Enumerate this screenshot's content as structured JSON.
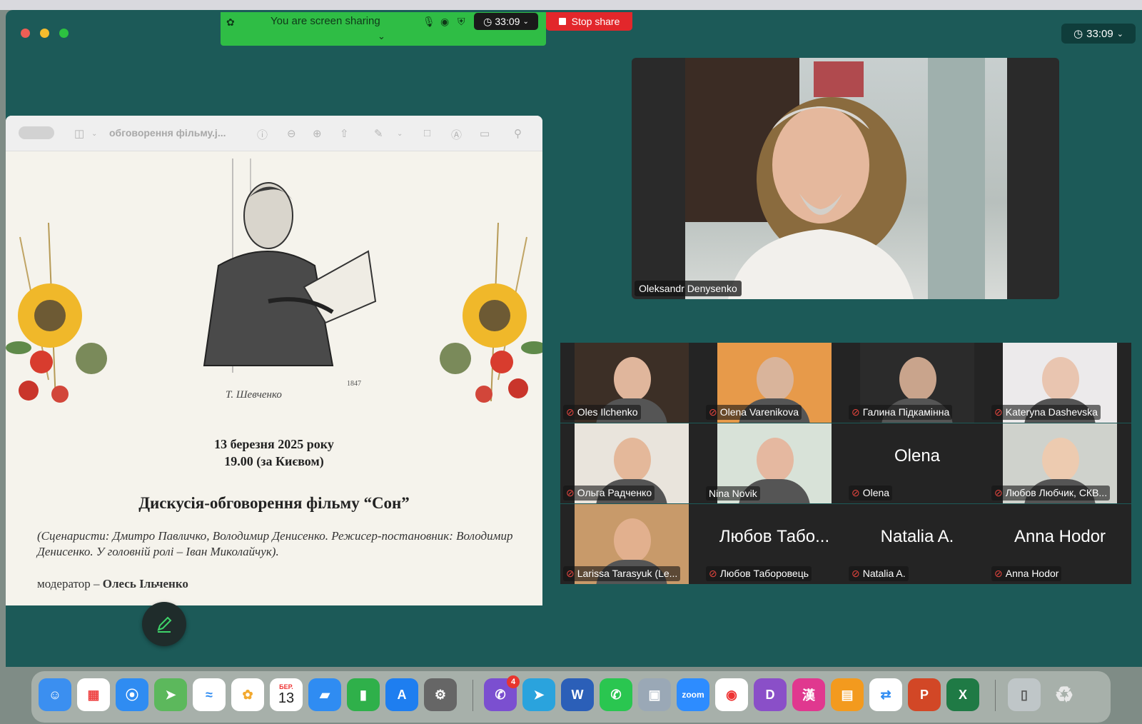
{
  "share_bar": {
    "label": "You are screen sharing",
    "timer": "33:09",
    "stop_label": "Stop share"
  },
  "meeting_timer": "33:09",
  "preview": {
    "doc_title": "обговорення фільму.j...",
    "date_line": "13 березня 2025 року",
    "time_line": "19.00 (за Києвом)",
    "heading": "Дискусія-обговорення фільму “Сон”",
    "credits": "(Сценаристи: Дмитро Павличко, Володимир Денисенко. Режисер-постановник: Володимир Денисенко. У головній ролі – Іван Миколайчук).",
    "moderator_prefix": "модератор – ",
    "moderator_name": "Олесь Ільченко",
    "signature": "Т. Шевченко",
    "sketch_year": "1847"
  },
  "speaker": {
    "name": "Oleksandr Denysenko"
  },
  "gallery": [
    {
      "name": "Oles Ilchenko",
      "muted": true,
      "video": true
    },
    {
      "name": "Olena Varenikova",
      "muted": true,
      "video": true
    },
    {
      "name": "Галина Підкамінна",
      "muted": true,
      "video": true
    },
    {
      "name": "Kateryna Dashevska",
      "muted": true,
      "video": true
    },
    {
      "name": "Ольга Радченко",
      "muted": true,
      "video": true
    },
    {
      "name": "Nina Novik",
      "muted": false,
      "video": true
    },
    {
      "name": "Olena",
      "muted": true,
      "video": false,
      "display": "Olena"
    },
    {
      "name": "Любов Любчик, СКВ...",
      "muted": true,
      "video": true
    },
    {
      "name": "Larissa Tarasyuk (Le...",
      "muted": true,
      "video": true
    },
    {
      "name": "Любов Таборовець",
      "muted": true,
      "video": false,
      "display": "Любов Табо..."
    },
    {
      "name": "Natalia A.",
      "muted": true,
      "video": false,
      "display": "Natalia A."
    },
    {
      "name": "Anna Hodor",
      "muted": true,
      "video": false,
      "display": "Anna Hodor"
    }
  ],
  "dock": {
    "calendar_month": "БЕР.",
    "calendar_day": "13",
    "viber_badge": "4",
    "zoom_label": "zoom"
  }
}
